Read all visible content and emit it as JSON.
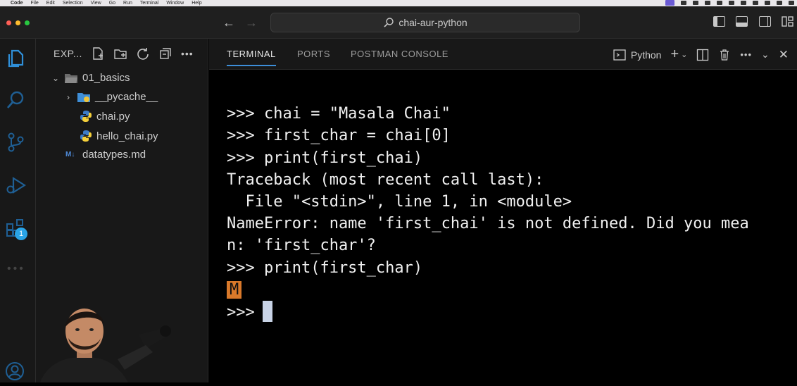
{
  "menubar": {
    "app_name": "Code",
    "items": [
      "File",
      "Edit",
      "Selection",
      "View",
      "Go",
      "Run",
      "Terminal",
      "Window",
      "Help"
    ]
  },
  "titlebar": {
    "search_text": "chai-aur-python",
    "traffic_lights": [
      "#ff5f57",
      "#febc2e",
      "#28c840"
    ]
  },
  "activity_bar": {
    "items": [
      "files-icon",
      "search-icon",
      "source-control-icon",
      "run-debug-icon",
      "extensions-icon"
    ],
    "extensions_badge": "1"
  },
  "explorer": {
    "title": "EXP...",
    "tree": [
      {
        "label": "01_basics",
        "type": "folder",
        "expanded": true
      },
      {
        "label": "__pycache__",
        "type": "folder",
        "expanded": false
      },
      {
        "label": "chai.py",
        "type": "python"
      },
      {
        "label": "hello_chai.py",
        "type": "python"
      },
      {
        "label": "datatypes.md",
        "type": "markdown",
        "icon_text": "M↓"
      }
    ]
  },
  "panel": {
    "tabs": [
      "TERMINAL",
      "PORTS",
      "POSTMAN CONSOLE"
    ],
    "active_tab": "TERMINAL",
    "shell": "Python"
  },
  "terminal": {
    "lines": [
      ">>> chai = \"Masala Chai\"",
      ">>> first_char = chai[0]",
      ">>> print(first_chai)",
      "Traceback (most recent call last):",
      "  File \"<stdin>\", line 1, in <module>",
      "NameError: name 'first_chai' is not defined. Did you mea",
      "n: 'first_char'?",
      ">>> print(first_char)"
    ],
    "output_highlight": "M",
    "prompt": ">>> "
  },
  "colors": {
    "accent_tab": "#3d8ed8",
    "highlight": "#d9792a",
    "badge": "#2aa4e6"
  }
}
